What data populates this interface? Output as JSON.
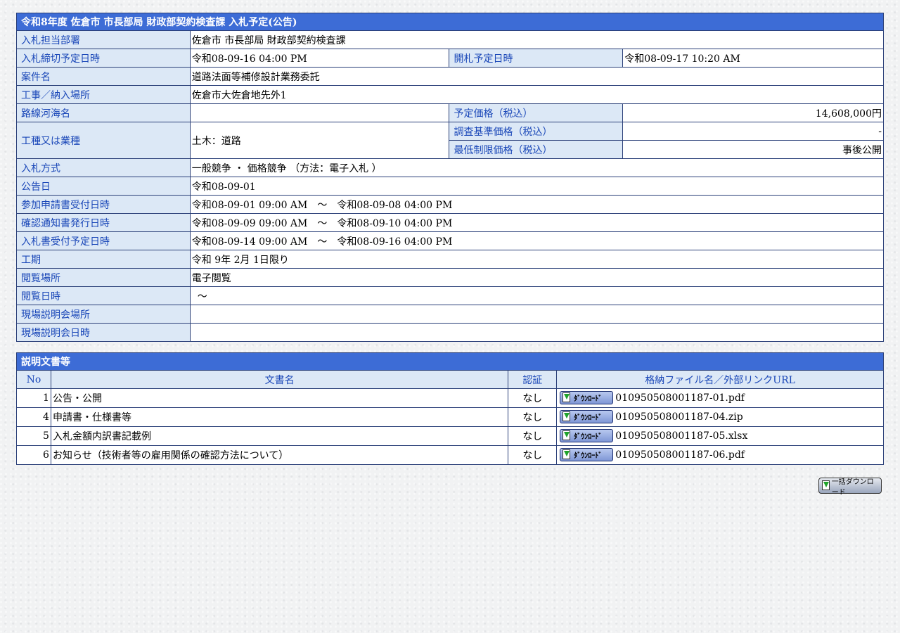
{
  "notice": {
    "title": "令和8年度 佐倉市 市長部局 財政部契約検査課 入札予定(公告)",
    "rows": {
      "dept": {
        "label": "入札担当部署",
        "value": "佐倉市 市長部局 財政部契約検査課"
      },
      "deadline": {
        "label": "入札締切予定日時",
        "value": "令和08-09-16 04:00 PM"
      },
      "opening": {
        "label": "開札予定日時",
        "value": "令和08-09-17 10:20 AM"
      },
      "project": {
        "label": "案件名",
        "value": "道路法面等補修設計業務委託"
      },
      "location": {
        "label": "工事／納入場所",
        "value": "佐倉市大佐倉地先外1"
      },
      "route": {
        "label": "路線河海名",
        "value": ""
      },
      "planned_price": {
        "label": "予定価格（税込）",
        "value": "14,608,000円"
      },
      "category": {
        "label": "工種又は業種",
        "value": "土木：道路"
      },
      "survey_price": {
        "label": "調査基準価格（税込）",
        "value": "-"
      },
      "min_price": {
        "label": "最低制限価格（税込）",
        "value": "事後公開"
      },
      "method": {
        "label": "入札方式",
        "value": "一般競争 ・ 価格競争 （方法：電子入札 ）"
      },
      "announce": {
        "label": "公告日",
        "value": "令和08-09-01"
      },
      "application": {
        "label": "参加申請書受付日時",
        "value": "令和08-09-01 09:00 AM　～　令和08-09-08 04:00 PM"
      },
      "confirm": {
        "label": "確認通知書発行日時",
        "value": "令和08-09-09 09:00 AM　～　令和08-09-10 04:00 PM"
      },
      "bid_receipt": {
        "label": "入札書受付予定日時",
        "value": "令和08-09-14 09:00 AM　～　令和08-09-16 04:00 PM"
      },
      "period": {
        "label": "工期",
        "value": "令和 9年 2月 1日限り"
      },
      "view_place": {
        "label": "閲覧場所",
        "value": "電子閲覧"
      },
      "view_time": {
        "label": "閲覧日時",
        "value": "～"
      },
      "site_place": {
        "label": "現場説明会場所",
        "value": ""
      },
      "site_time": {
        "label": "現場説明会日時",
        "value": ""
      }
    }
  },
  "documents": {
    "title": "説明文書等",
    "columns": {
      "no": "No",
      "name": "文書名",
      "cert": "認証",
      "file": "格納ファイル名／外部リンクURL"
    },
    "download_label": "ﾀﾞｳﾝﾛｰﾄﾞ",
    "bulk_download_label": "一括ダウンロード",
    "rows": [
      {
        "no": "1",
        "name": "公告・公開",
        "cert": "なし",
        "file": "010950508001187-01.pdf"
      },
      {
        "no": "4",
        "name": "申請書・仕様書等",
        "cert": "なし",
        "file": "010950508001187-04.zip"
      },
      {
        "no": "5",
        "name": "入札金額内訳書記載例",
        "cert": "なし",
        "file": "010950508001187-05.xlsx"
      },
      {
        "no": "6",
        "name": "お知らせ（技術者等の雇用関係の確認方法について）",
        "cert": "なし",
        "file": "010950508001187-06.pdf"
      }
    ]
  }
}
